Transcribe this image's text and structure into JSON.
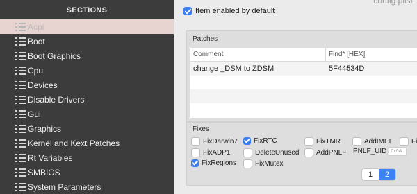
{
  "window": {
    "title": "config.plist"
  },
  "sidebar": {
    "header": "SECTIONS",
    "items": [
      {
        "label": "Acpi",
        "selected": true
      },
      {
        "label": "Boot"
      },
      {
        "label": "Boot Graphics"
      },
      {
        "label": "Cpu"
      },
      {
        "label": "Devices"
      },
      {
        "label": "Disable Drivers"
      },
      {
        "label": "Gui"
      },
      {
        "label": "Graphics"
      },
      {
        "label": "Kernel and Kext Patches"
      },
      {
        "label": "Rt Variables"
      },
      {
        "label": "SMBIOS"
      },
      {
        "label": "System Parameters"
      }
    ]
  },
  "main": {
    "item_enabled_label": "Item enabled by default",
    "patches": {
      "title": "Patches",
      "columns": [
        "Comment",
        "Find* [HEX]"
      ],
      "rows": [
        {
          "comment": "change _DSM to ZDSM",
          "find": "5F44534D"
        }
      ]
    },
    "fixes": {
      "title": "Fixes",
      "items": [
        {
          "label": "FixDarwin7",
          "checked": false
        },
        {
          "label": "FixRTC",
          "checked": true
        },
        {
          "label": "FixTMR",
          "checked": false
        },
        {
          "label": "AddIMEI",
          "checked": false
        },
        {
          "label": "FixI",
          "checked": false
        },
        {
          "label": "FixADP1",
          "checked": false
        },
        {
          "label": "DeleteUnused",
          "checked": false
        },
        {
          "label": "AddPNLF",
          "checked": false
        },
        {
          "label": "FixRegions",
          "checked": true
        },
        {
          "label": "FixMutex",
          "checked": false
        }
      ],
      "pnlf_uid_label": "PNLF_UID",
      "pnlf_uid_placeholder": "0x0A"
    },
    "pager": {
      "pages": [
        "1",
        "2"
      ],
      "active": "2"
    }
  },
  "colors": {
    "accent": "#3b7ff0",
    "sidebar_bg": "#3c3c3c",
    "selected_item_bg": "#e7d4d1"
  },
  "icons": {
    "sidebar_item": "list-icon",
    "checkbox": "checkbox-icon"
  }
}
